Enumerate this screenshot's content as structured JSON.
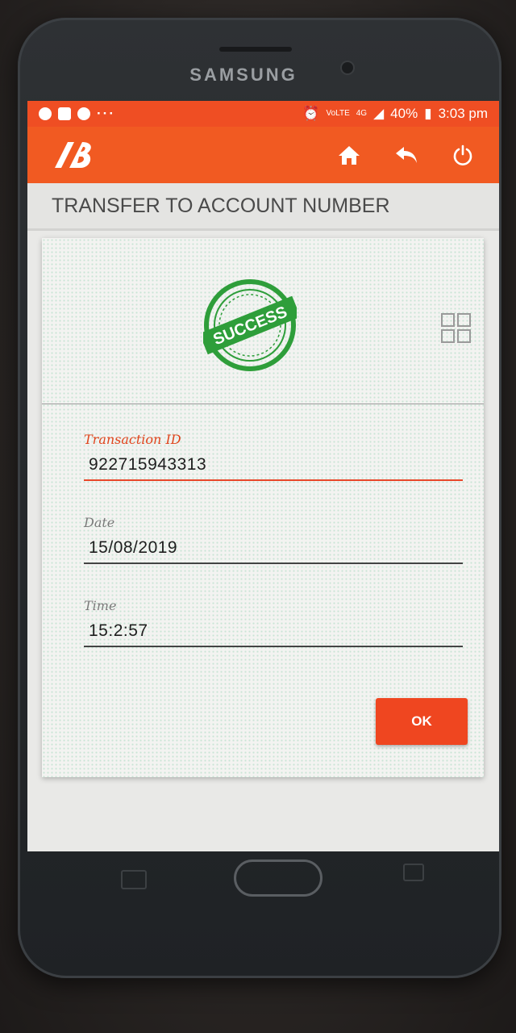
{
  "device": {
    "brand": "SAMSUNG"
  },
  "status_bar": {
    "dots": "···",
    "network": "4G",
    "volte": "VoLTE",
    "battery": "40%",
    "time": "3:03 pm"
  },
  "app_bar": {
    "logo": "bank-logo",
    "icons": [
      "home-icon",
      "back-arrow-icon",
      "power-icon"
    ],
    "accent_color": "#f15a22"
  },
  "page": {
    "title": "TRANSFER TO ACCOUNT NUMBER",
    "stamp_text": "SUCCESS",
    "stamp_color": "#2e9e3a"
  },
  "fields": {
    "transaction_id": {
      "label": "Transaction ID",
      "value": "922715943313"
    },
    "date": {
      "label": "Date",
      "value": "15/08/2019"
    },
    "time": {
      "label": "Time",
      "value": "15:2:57"
    }
  },
  "actions": {
    "ok_label": "OK"
  }
}
